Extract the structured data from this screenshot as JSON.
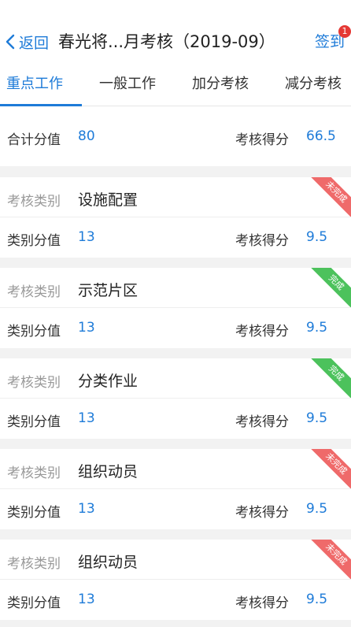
{
  "nav": {
    "back_label": "返回",
    "title": "春光将...月考核（2019-09）",
    "signin_label": "签到",
    "badge_count": "1"
  },
  "tabs": [
    {
      "label": "重点工作",
      "active": true
    },
    {
      "label": "一般工作",
      "active": false
    },
    {
      "label": "加分考核",
      "active": false
    },
    {
      "label": "减分考核",
      "active": false
    }
  ],
  "summary": {
    "total_label": "合计分值",
    "total_value": "80",
    "score_label": "考核得分",
    "score_value": "66.5"
  },
  "card_labels": {
    "category_label": "考核类别",
    "category_points_label": "类别分值",
    "score_label": "考核得分"
  },
  "cards": [
    {
      "category": "设施配置",
      "points": "13",
      "score": "9.5",
      "status": "未完成",
      "status_color": "#ef6a6a"
    },
    {
      "category": "示范片区",
      "points": "13",
      "score": "9.5",
      "status": "完成",
      "status_color": "#4cc25c"
    },
    {
      "category": "分类作业",
      "points": "13",
      "score": "9.5",
      "status": "完成",
      "status_color": "#4cc25c"
    },
    {
      "category": "组织动员",
      "points": "13",
      "score": "9.5",
      "status": "未完成",
      "status_color": "#ef6a6a"
    },
    {
      "category": "组织动员",
      "points": "13",
      "score": "9.5",
      "status": "未完成",
      "status_color": "#ef6a6a"
    }
  ],
  "colors": {
    "accent": "#1e7bd8",
    "done": "#4cc25c",
    "undone": "#ef6a6a"
  }
}
